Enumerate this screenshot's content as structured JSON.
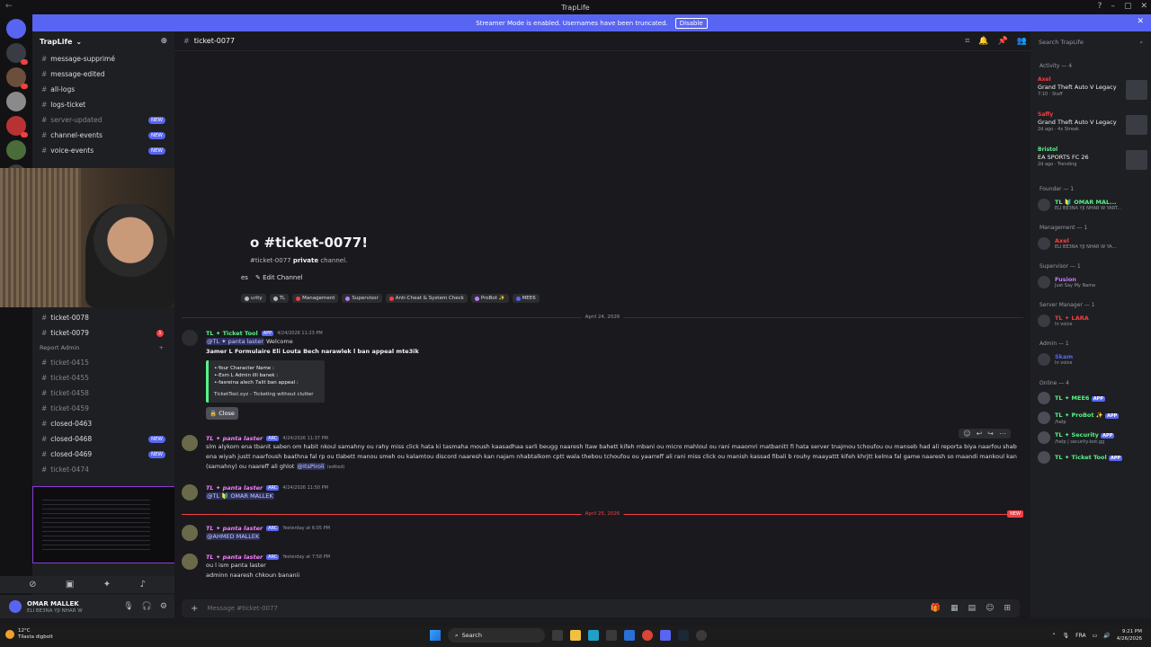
{
  "window": {
    "title": "TrapLife"
  },
  "banner": {
    "text": "Streamer Mode is enabled. Usernames have been truncated.",
    "button": "Disable"
  },
  "server": {
    "name": "TrapLife"
  },
  "channels_top": [
    {
      "name": "message-supprimé",
      "new": false
    },
    {
      "name": "message-edited",
      "new": false
    },
    {
      "name": "all-logs",
      "new": false
    },
    {
      "name": "logs-ticket",
      "new": false
    },
    {
      "name": "server-updated",
      "new": true,
      "muted": true
    },
    {
      "name": "channel-events",
      "new": true
    },
    {
      "name": "voice-events",
      "new": true
    }
  ],
  "new_label": "NEW",
  "channels_tickets": [
    {
      "name": "ticket-0078"
    },
    {
      "name": "ticket-0079",
      "badge": "1"
    }
  ],
  "category_report": "Report Admin",
  "channels_report": [
    {
      "name": "ticket-0415",
      "muted": true
    },
    {
      "name": "ticket-0455",
      "muted": true
    },
    {
      "name": "ticket-0458",
      "muted": true
    },
    {
      "name": "ticket-0459",
      "muted": true
    },
    {
      "name": "closed-0463",
      "muted": false
    },
    {
      "name": "closed-0468",
      "muted": false,
      "new": true
    },
    {
      "name": "closed-0469",
      "muted": false,
      "new": true
    },
    {
      "name": "ticket-0474",
      "muted": true
    }
  ],
  "user": {
    "name": "OMAR MALLEK",
    "status": "ELI BE3NA YJI NHAR W"
  },
  "channel": {
    "name": "ticket-0077"
  },
  "welcome": {
    "title": "o #ticket-0077!",
    "sub_prefix": "#ticket-0077",
    "sub_bold": "private",
    "sub_suffix": "channel.",
    "edit": "Edit Channel",
    "edit_prefix": "es"
  },
  "roles": [
    {
      "name": "urity",
      "color": "#b5bac1"
    },
    {
      "name": "TL",
      "color": "#b5bac1"
    },
    {
      "name": "Management",
      "color": "#f23f43"
    },
    {
      "name": "Supervisor",
      "color": "#c27cff"
    },
    {
      "name": "Anti-Cheat & System Check",
      "color": "#f23f43"
    },
    {
      "name": "ProBot ✨",
      "color": "#c27cff"
    },
    {
      "name": "MEE6",
      "color": "#5865f2"
    }
  ],
  "date1": "April 24, 2026",
  "date2": "April 25, 2026",
  "messages": {
    "m1": {
      "author": "Ticket Tool",
      "prefix": "TL ✦",
      "tag": "APP",
      "time": "4/24/2026 11:23 PM",
      "line1_mention": "@TL ✦ panta laster",
      "line1_rest": "Welcome",
      "line2": "3amer L Formulaire Eli Louta Bech narawlek l ban appeal mte3ik",
      "embed": [
        "•-Your Character Name :",
        "•-Esm L Admin illi banek :",
        "•-fasreina alech 7alit ban appeal :",
        "TicketTool.xyz - Ticketing without clutter"
      ],
      "button": "Close"
    },
    "m2": {
      "author": "panta laster",
      "prefix": "TL ✦",
      "tag": "ARC",
      "time": "4/24/2026 11:37 PM",
      "text": "slm alykom ena tbanit saben om habit nkoul samahny ou rahy miss click hata ki tasmaha moush kaasadhaa sarli beugg naaresh ltaw bahett kifeh mbani ou micro mahloul ou rani maaomri matbanitt fi hata server tnajmou tchoufou ou manseb had ali reporta biya naarfou shab ena wiyah justt naarfoush baathna fal rp ou tlabett manou smeh ou kalamtou discord naaresh kan najam nhabtalkom cptt wala thebou tchoufou ou yaarreff ali rani miss click ou manish kassad fibali b rouhy maayattt kifeh khrjtt kelma fal game naaresh so maandi mankoul kan (samahny) ou naareff ali ghlot",
      "mention": "@ItsPiroli",
      "edited": "(edited)"
    },
    "m3": {
      "author": "panta laster",
      "prefix": "TL ✦",
      "tag": "ARC",
      "time": "4/24/2026 11:50 PM",
      "mention": "@TL 🔰 OMAR MALLEK"
    },
    "m4": {
      "author": "panta laster",
      "prefix": "TL ✦",
      "tag": "ARC",
      "time": "Yesterday at 6:05 PM",
      "mention": "@AHMED MALLEK"
    },
    "m5": {
      "author": "panta laster",
      "prefix": "TL ✦",
      "tag": "ARC",
      "time": "Yesterday at 7:58 PM",
      "line1": "ou l ism panta laster",
      "line2": "adminn naaresh chkoun bananii"
    }
  },
  "input_placeholder": "Message #ticket-0077",
  "search_placeholder": "Search TrapLife",
  "activity": {
    "header": "Activity — 4",
    "items": [
      {
        "name": "Axel",
        "game": "Grand Theft Auto V Legacy",
        "sub": "7:10 · Staff",
        "green": false
      },
      {
        "name": "Saffy",
        "game": "Grand Theft Auto V Legacy",
        "sub": "2d ago · 4x Streak",
        "green": false
      },
      {
        "name": "Bristol",
        "game": "EA SPORTS FC 26",
        "sub": "2d ago · Trending",
        "green": true
      }
    ]
  },
  "member_groups": [
    {
      "header": "Founder — 1",
      "name": "TL 🔰 OMAR MAL...",
      "sub": "ELI BE3NA YJI NHAR W YART...",
      "color": "#57f287"
    },
    {
      "header": "Management — 1",
      "name": "Axel",
      "sub": "ELI BE3NA YJI NHAR W YA...",
      "color": "#f23f43"
    },
    {
      "header": "Supervisor — 1",
      "name": "Fusion",
      "sub": "Just Say My Name",
      "color": "#c27cff"
    },
    {
      "header": "Server Manager — 1",
      "name": "TL ✦ LARA",
      "sub": "In voice",
      "color": "#f23f43"
    },
    {
      "header": "Admin — 1",
      "name": "Skam",
      "sub": "In voice",
      "color": "#5865f2"
    }
  ],
  "online": {
    "header": "Online — 4",
    "items": [
      {
        "name": "TL ✦ MEE6",
        "sub": ""
      },
      {
        "name": "TL ✦ ProBot ✨",
        "sub": "/help"
      },
      {
        "name": "TL ✦ Security",
        "sub": "/help | security-bot.gg"
      },
      {
        "name": "TL ✦ Ticket Tool",
        "sub": ""
      }
    ]
  },
  "app_tag": "APP",
  "taskbar": {
    "temp": "12°C",
    "weather": "Tilasta digbolt",
    "search": "Search",
    "lang": "FRA",
    "time": "9:21 PM",
    "date": "4/26/2026"
  }
}
